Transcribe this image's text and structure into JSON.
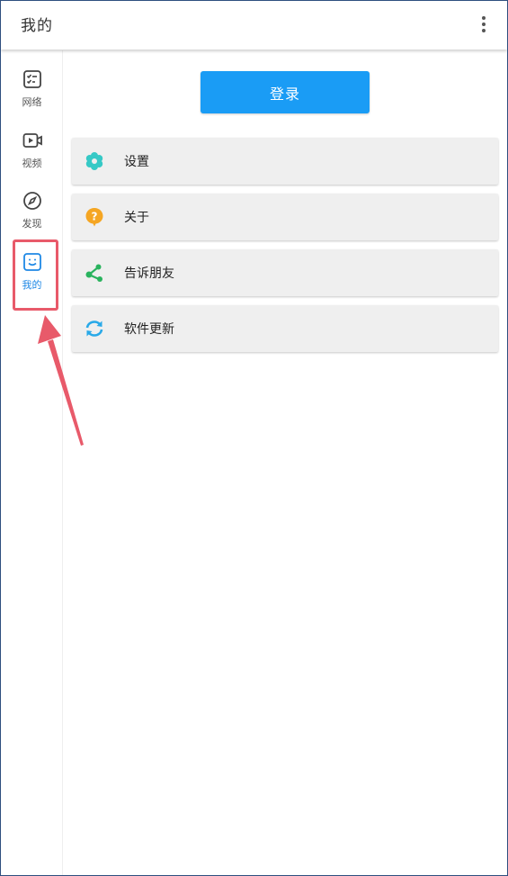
{
  "appbar": {
    "title": "我的"
  },
  "sidebar": {
    "items": [
      {
        "label": "网络",
        "icon": "network-list-icon"
      },
      {
        "label": "视频",
        "icon": "video-icon"
      },
      {
        "label": "发现",
        "icon": "compass-icon"
      },
      {
        "label": "我的",
        "icon": "smile-face-icon",
        "active": true
      }
    ],
    "active_color": "#1e88e5"
  },
  "main": {
    "login_label": "登录",
    "menu": [
      {
        "label": "设置",
        "icon": "settings-flower-icon",
        "color": "#36c9c6"
      },
      {
        "label": "关于",
        "icon": "question-icon",
        "color": "#f5a623"
      },
      {
        "label": "告诉朋友",
        "icon": "share-icon",
        "color": "#2ab35e"
      },
      {
        "label": "软件更新",
        "icon": "refresh-icon",
        "color": "#29a9e8"
      }
    ]
  },
  "colors": {
    "primary": "#1a9cf5",
    "highlight": "#e85a6a"
  }
}
